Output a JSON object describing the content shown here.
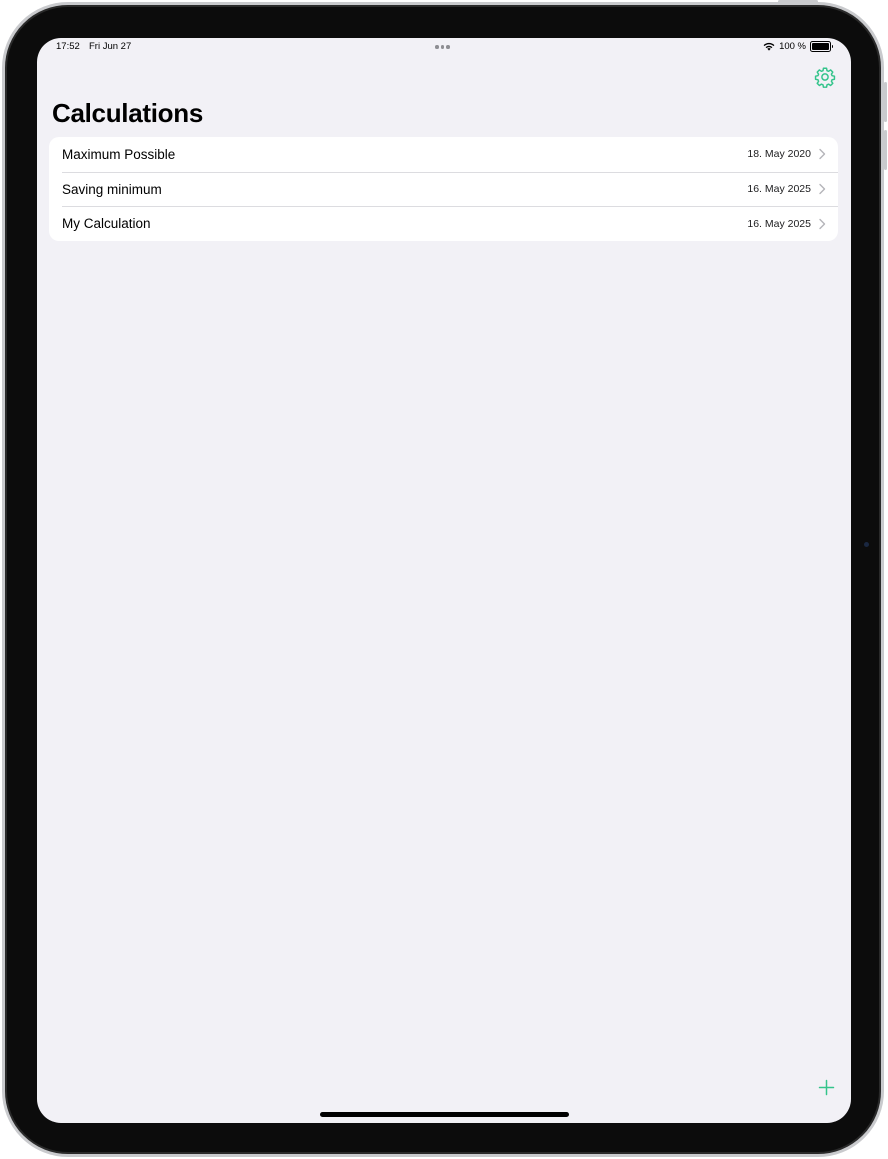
{
  "status_bar": {
    "time": "17:52",
    "date": "Fri Jun 27",
    "battery": "100 %"
  },
  "header": {
    "title": "Calculations",
    "settings_icon": "gear-icon"
  },
  "calculations": [
    {
      "title": "Maximum Possible",
      "date": "18. May 2020"
    },
    {
      "title": "Saving minimum",
      "date": "16. May 2025"
    },
    {
      "title": "My Calculation",
      "date": "16. May 2025"
    }
  ],
  "toolbar": {
    "add_icon": "plus-icon"
  },
  "colors": {
    "accent": "#34c48b",
    "background": "#f2f1f6",
    "card": "#ffffff"
  }
}
